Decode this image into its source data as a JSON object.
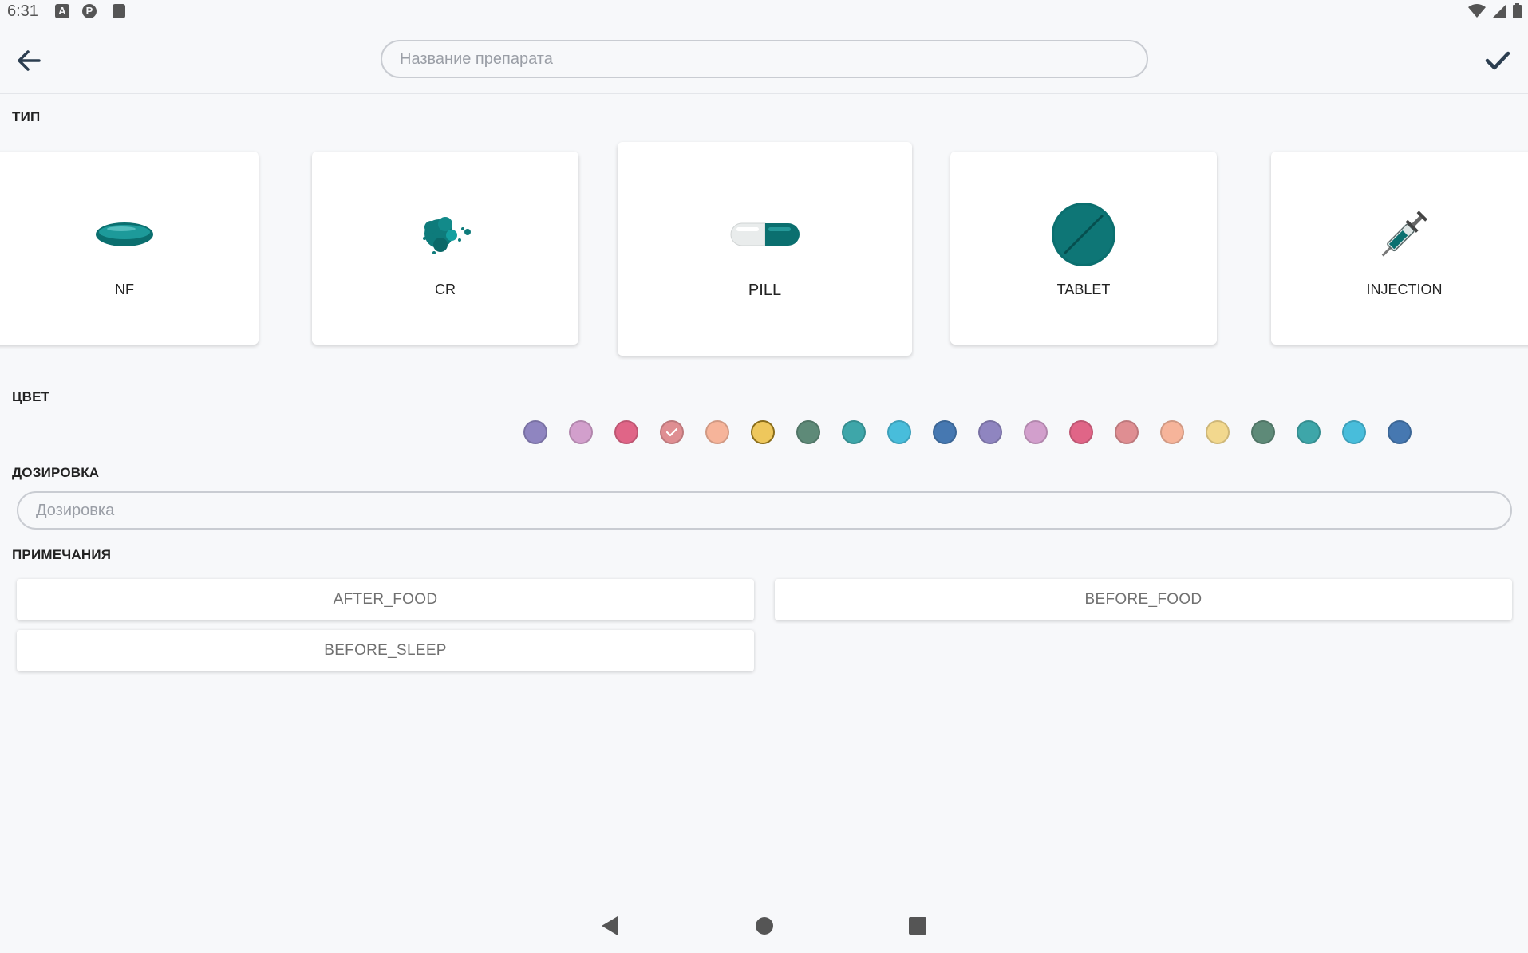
{
  "status_bar": {
    "time": "6:31",
    "icons": [
      "a-icon",
      "pocket-icon",
      "sd-card-icon"
    ],
    "right_icons": [
      "wifi-icon",
      "signal-icon",
      "battery-icon"
    ]
  },
  "toolbar": {
    "back_icon": "arrow-left-icon",
    "name_placeholder": "Название препарата",
    "name_value": "",
    "confirm_icon": "checkmark-icon"
  },
  "type_section": {
    "label": "ТИП",
    "items": [
      {
        "label": "NF",
        "icon": "capsule-oval-icon",
        "selected": false
      },
      {
        "label": "CR",
        "icon": "powder-icon",
        "selected": false
      },
      {
        "label": "PILL",
        "icon": "pill-capsule-icon",
        "selected": true
      },
      {
        "label": "TABLET",
        "icon": "tablet-icon",
        "selected": false
      },
      {
        "label": "INJECTION",
        "icon": "syringe-icon",
        "selected": false
      }
    ]
  },
  "color_section": {
    "label": "ЦВЕТ",
    "swatches": [
      "#8f85c0",
      "#d29fcc",
      "#e06587",
      "#df8e92",
      "#f6b49a",
      "#eec75c",
      "#5e8a78",
      "#3ea6a9",
      "#48bddb",
      "#4678b1",
      "#8f85c0",
      "#d29fcc",
      "#e06587",
      "#df8e92",
      "#f6b49a",
      "#f2d88e",
      "#5e8a78",
      "#3ea6a9",
      "#48bddb",
      "#4678b1"
    ],
    "selected_index": 5,
    "checked_index": 3
  },
  "dosage_section": {
    "label": "ДОЗИРОВКА",
    "placeholder": "Дозировка",
    "value": ""
  },
  "notes_section": {
    "label": "ПРИМЕЧАНИЯ",
    "options": [
      "AFTER_FOOD",
      "BEFORE_FOOD",
      "BEFORE_SLEEP"
    ]
  },
  "nav_bar": {
    "icons": [
      "back-triangle-icon",
      "home-circle-icon",
      "recents-square-icon"
    ]
  },
  "colors": {
    "accent": "#0b6f6f",
    "border": "#c9ccd2",
    "background": "#f7f8fa"
  }
}
